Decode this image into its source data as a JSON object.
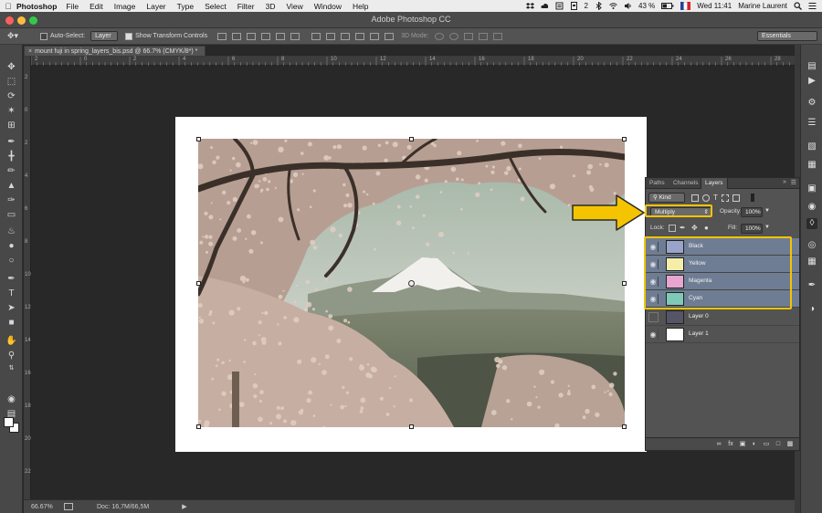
{
  "menubar": {
    "app_name": "Photoshop",
    "menus": [
      "File",
      "Edit",
      "Image",
      "Layer",
      "Type",
      "Select",
      "Filter",
      "3D",
      "View",
      "Window",
      "Help"
    ],
    "battery": "43 %",
    "clock": "Wed 11:41",
    "user": "Marine Laurent",
    "badge_number": "2"
  },
  "window": {
    "title": "Adobe Photoshop CC"
  },
  "options": {
    "auto_select_label": "Auto-Select:",
    "auto_select_value": "Layer",
    "show_transform_label": "Show Transform Controls",
    "mode_3d_label": "3D Mode:",
    "workspace": "Essentials"
  },
  "document": {
    "tab_title": "mount fuji in spring_layers_bis.psd @ 66.7% (CMYK/8*) *",
    "zoom": "66.67%",
    "doc_size": "Doc: 16,7M/66,5M"
  },
  "rulers": {
    "top": [
      "2",
      "0",
      "2",
      "4",
      "6",
      "8",
      "10",
      "12",
      "14",
      "16",
      "18",
      "20",
      "22",
      "24",
      "26",
      "28"
    ],
    "left": [
      "2",
      "0",
      "2",
      "4",
      "6",
      "8",
      "10",
      "12",
      "14",
      "16",
      "18",
      "20",
      "22"
    ]
  },
  "layers_panel": {
    "tabs": [
      "Paths",
      "Channels",
      "Layers"
    ],
    "active_tab": "Layers",
    "filter_kind": "Kind",
    "blend_mode": "Multiply",
    "opacity_label": "Opacity:",
    "opacity_value": "100%",
    "lock_label": "Lock:",
    "fill_label": "Fill:",
    "fill_value": "100%",
    "layers": [
      {
        "name": "Black",
        "selected": true,
        "visible": true,
        "thumb_color": "#9aa3c9"
      },
      {
        "name": "Yellow",
        "selected": true,
        "visible": true,
        "thumb_color": "#f4eea8"
      },
      {
        "name": "Magenta",
        "selected": true,
        "visible": true,
        "thumb_color": "#e6a6cf"
      },
      {
        "name": "Cyan",
        "selected": true,
        "visible": true,
        "thumb_color": "#7fc9b8"
      },
      {
        "name": "Layer 0",
        "selected": false,
        "visible": false,
        "thumb_color": "#556"
      },
      {
        "name": "Layer 1",
        "selected": false,
        "visible": true,
        "thumb_color": "#ffffff"
      }
    ]
  },
  "colors": {
    "highlight": "#f5c400",
    "selected_row": "#6e7d93"
  }
}
